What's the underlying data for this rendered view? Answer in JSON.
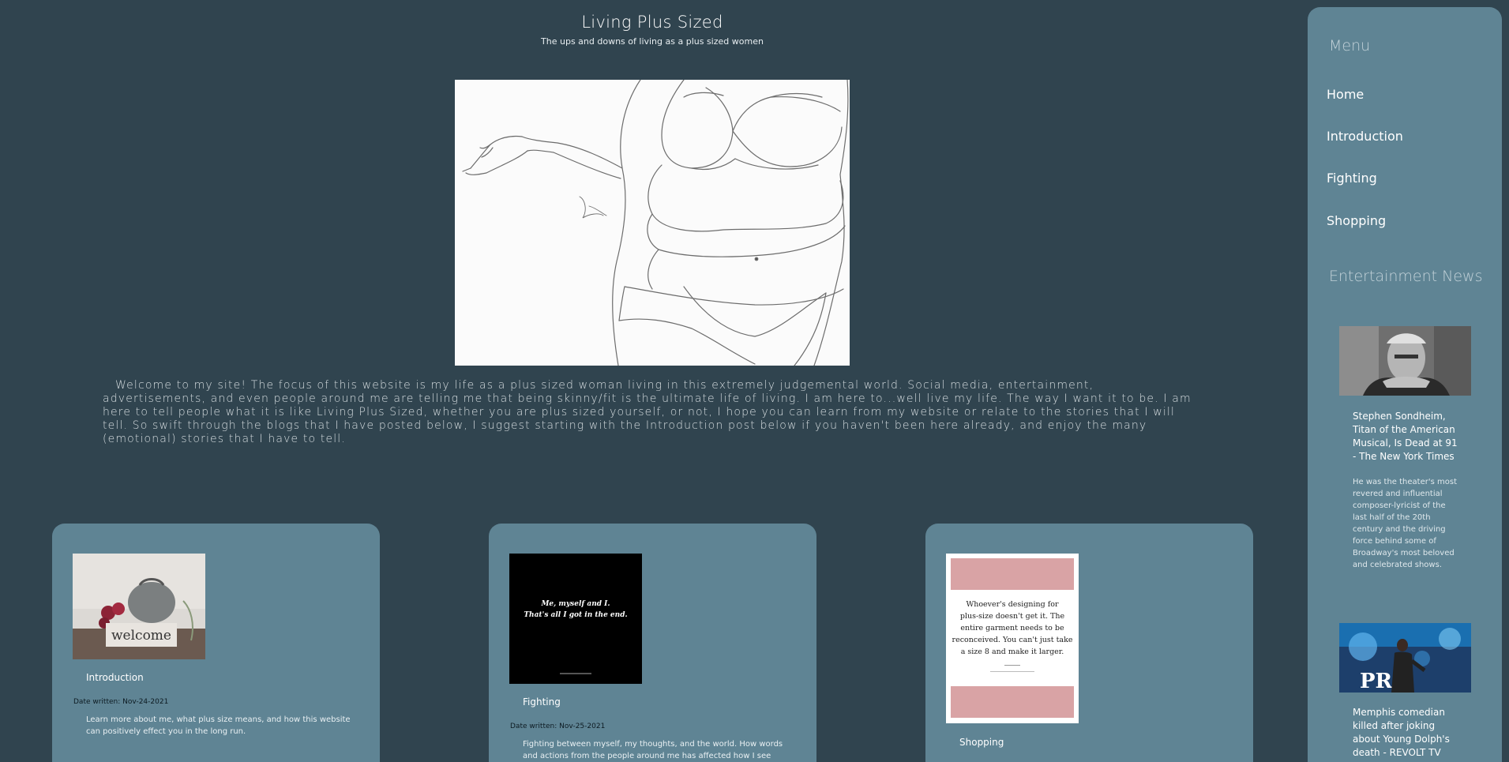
{
  "header": {
    "title": "Living Plus Sized",
    "subtitle": "The ups and downs of living as a plus sized women"
  },
  "hero": {
    "image_alt": "Line sketch of a plus sized woman in lingerie"
  },
  "intro": {
    "text": "Welcome to my site! The focus of this website is my life as a plus sized woman living in this extremely judgemental world. Social media, entertainment, advertisements, and even people around me are telling me that being skinny/fit is the ultimate life of living. I am here to...well live my life. The way I want it to be. I am here to tell people what it is like Living Plus Sized, whether you are plus sized yourself, or not, I hope you can learn from my website or relate to the stories that I will tell. So swift through the blogs that I have posted below, I suggest starting with the Introduction post below if you haven't been here already, and enjoy the many (emotional) stories that I have to tell."
  },
  "cards": [
    {
      "title": "Introduction",
      "date": "Date written: Nov-24-2021",
      "description": "Learn more about me, what plus size means, and how this website can positively effect you in the long run.",
      "thumb_text": "welcome"
    },
    {
      "title": "Fighting",
      "date": "Date written: Nov-25-2021",
      "description": "Fighting between myself, my thoughts, and the world. How words and actions from the people around me has affected how I see myself.",
      "thumb_text": "Me, myself and I. That's all I got in the end."
    },
    {
      "title": "Shopping",
      "thumb_text": "Whoever's designing for plus-size doesn't get it. The entire garment needs to be reconceived. You can't just take a size 8 and make it larger."
    }
  ],
  "sidebar": {
    "menu_heading": "Menu",
    "menu_items": [
      "Home",
      "Introduction",
      "Fighting",
      "Shopping"
    ],
    "news_heading": "Entertainment News",
    "news": [
      {
        "title": "Stephen Sondheim, Titan of the American Musical, Is Dead at 91 - The New York Times",
        "description": "He was the theater's most revered and influential composer-lyricist of the last half of the 20th century and the driving force behind some of Broadway's most beloved and celebrated shows."
      },
      {
        "title": "Memphis comedian killed after joking about Young Dolph's death - REVOLT TV",
        "image_text": "PR"
      }
    ]
  },
  "colors": {
    "background": "#30444f",
    "panel": "#5f8494",
    "heading_muted": "#c1d1d8"
  }
}
